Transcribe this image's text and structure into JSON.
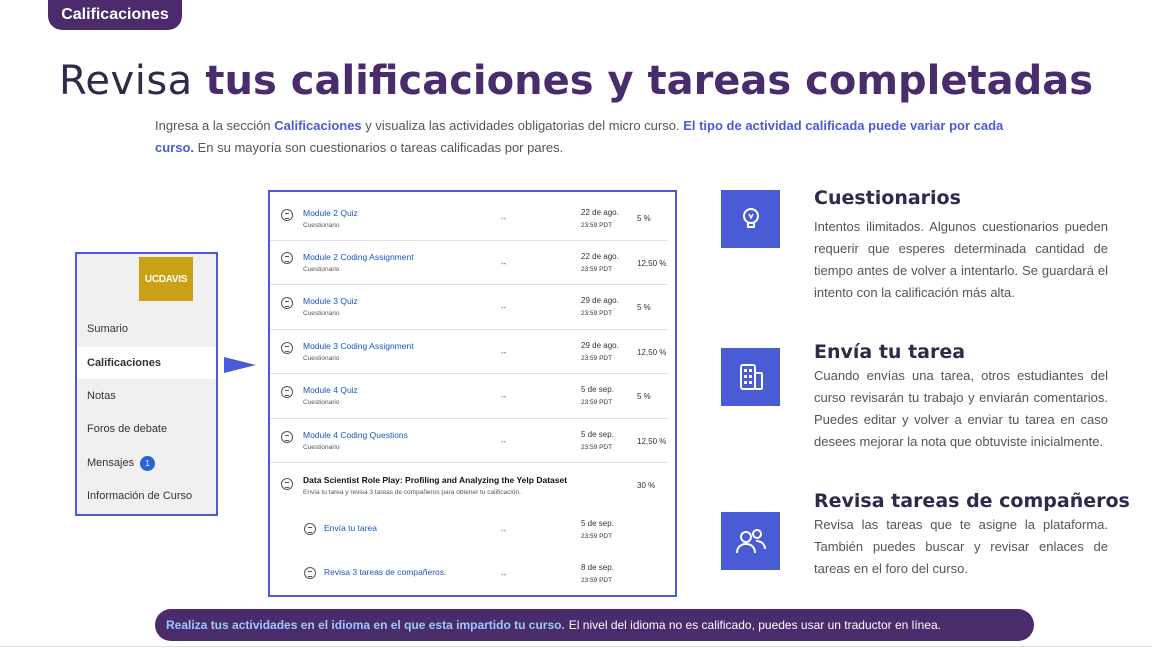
{
  "tag": "Calificaciones",
  "headline": {
    "light": "Revisa",
    "bold": "tus calificaciones y tareas completadas"
  },
  "intro": {
    "p1": "Ingresa a la sección ",
    "p2": "Calificaciones",
    "p3": " y visualiza las actividades obligatorias del micro curso. ",
    "p4": "El tipo de actividad calificada puede variar por cada curso.",
    "p5": " En su mayoría son cuestionarios o tareas calificadas por pares."
  },
  "sidebar": {
    "logo": "UCDAVIS",
    "items": [
      "Sumario",
      "Calificaciones",
      "Notas",
      "Foros de debate",
      "Mensajes",
      "Información de Curso"
    ],
    "badge": "1"
  },
  "table": {
    "rows": [
      {
        "title": "Module 2 Quiz",
        "sub": "Cuestionario",
        "dash": "--",
        "date": "22 de ago.",
        "time": "23:59 PDT",
        "pct": "5 %"
      },
      {
        "title": "Module 2 Coding Assignment",
        "sub": "Cuestionario",
        "dash": "--",
        "date": "22 de ago.",
        "time": "23:59 PDT",
        "pct": "12,50 %"
      },
      {
        "title": "Module 3 Quiz",
        "sub": "Cuestionario",
        "dash": "--",
        "date": "29 de ago.",
        "time": "23:59 PDT",
        "pct": "5 %"
      },
      {
        "title": "Module 3 Coding Assignment",
        "sub": "Cuestionario",
        "dash": "--",
        "date": "29 de ago.",
        "time": "23:59 PDT",
        "pct": "12,50 %"
      },
      {
        "title": "Module 4 Quiz",
        "sub": "Cuestionario",
        "dash": "--",
        "date": "5 de sep.",
        "time": "23:59 PDT",
        "pct": "5 %"
      },
      {
        "title": "Module 4 Coding Questions",
        "sub": "Cuestionario",
        "dash": "--",
        "date": "5 de sep.",
        "time": "23:59 PDT",
        "pct": "12,50 %"
      }
    ],
    "peer": {
      "title": "Data Scientist Role Play: Profiling and Analyzing the Yelp Dataset",
      "sub": "Envía tu tarea y revisa 3 tareas de compañeros para obtener tu calificación.",
      "pct": "30 %",
      "sub1": {
        "title": "Envía tu tarea",
        "dash": "--",
        "date": "5 de sep.",
        "time": "23:59 PDT"
      },
      "sub2": {
        "title": "Revisa 3 tareas de compañeros.",
        "dash": "--",
        "date": "8 de sep.",
        "time": "23:59 PDT"
      }
    }
  },
  "features": [
    {
      "title": "Cuestionarios",
      "text": "Intentos ilimitados. Algunos cuestionarios pueden requerir que esperes determinada cantidad de tiempo antes de volver a intentarlo. Se guardará el intento con la calificación más alta."
    },
    {
      "title": "Envía tu tarea",
      "text": "Cuando envías una tarea, otros estudiantes del curso revisarán tu trabajo y enviarán comentarios. Puedes editar y volver a enviar tu tarea en caso desees mejorar la nota que obtuviste inicialmente."
    },
    {
      "title": "Revisa tareas de compañeros",
      "text": "Revisa las tareas que te asigne la plataforma. También puedes buscar y revisar enlaces de tareas en el foro del curso."
    }
  ],
  "bottom": {
    "hl": "Realiza tus actividades en el idioma en el que esta impartido tu curso.",
    "rest": "El nivel del idioma no es calificado, puedes usar un traductor en línea."
  },
  "icons": [
    "lightbulb-icon",
    "building-icon",
    "people-icon",
    "quiz-icon",
    "peer-review-icon",
    "forum-icon"
  ]
}
